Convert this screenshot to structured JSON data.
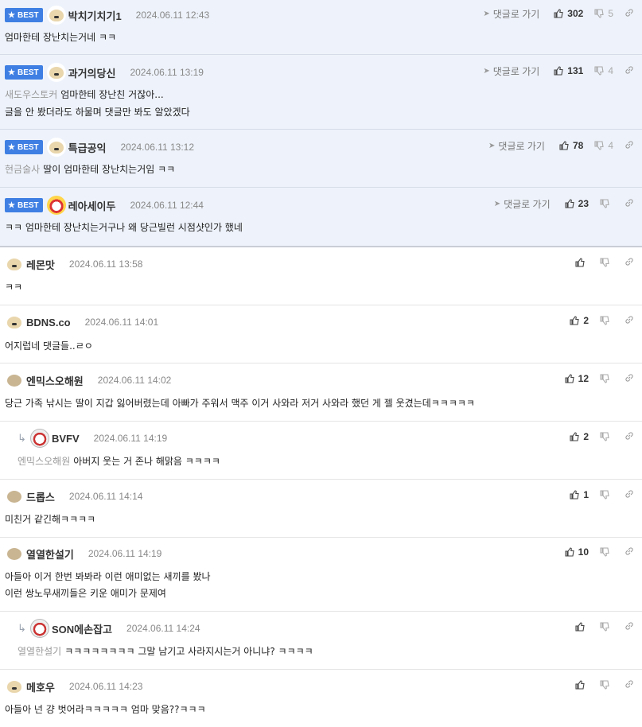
{
  "labels": {
    "best": "BEST",
    "reply_link": "댓글로 가기"
  },
  "comments": [
    {
      "nick": "박치기치기1",
      "date": "2024.06.11 12:43",
      "mention": "",
      "line1": "엄마한테 장난치는거네 ㅋㅋ",
      "line2": "",
      "up": "302",
      "down": "5"
    },
    {
      "nick": "과거의당신",
      "date": "2024.06.11 13:19",
      "mention": "새도우스토커",
      "line1": "엄마한테 장난친 거잖아...",
      "line2": "글을 안 봤더라도 하물며 댓글만 봐도 알았겠다",
      "up": "131",
      "down": "4"
    },
    {
      "nick": "특급공익",
      "date": "2024.06.11 13:12",
      "mention": "현금술사",
      "line1": "딸이 엄마한테 장난치는거임 ㅋㅋ",
      "line2": "",
      "up": "78",
      "down": "4"
    },
    {
      "nick": "레아세이두",
      "date": "2024.06.11 12:44",
      "mention": "",
      "line1": "ㅋㅋ 엄마한테 장난치는거구나 왜 당근빌런 시점샷인가 했네",
      "line2": "",
      "up": "23",
      "down": ""
    },
    {
      "nick": "레몬맛",
      "date": "2024.06.11 13:58",
      "mention": "",
      "line1": "ㅋㅋ",
      "line2": "",
      "up": "",
      "down": ""
    },
    {
      "nick": "BDNS.co",
      "date": "2024.06.11 14:01",
      "mention": "",
      "line1": "어지럽네 댓글들..ㄹㅇ",
      "line2": "",
      "up": "2",
      "down": ""
    },
    {
      "nick": "엔믹스오해원",
      "date": "2024.06.11 14:02",
      "mention": "",
      "line1": "당근 가족 낚시는 딸이 지갑 잃어버렸는데 아빠가 주워서 맥주 이거 사와라 저거 사와라 했던 게 젤 웃겼는데ㅋㅋㅋㅋㅋ",
      "line2": "",
      "up": "12",
      "down": ""
    },
    {
      "nick": "BVFV",
      "date": "2024.06.11 14:19",
      "mention": "엔믹스오해원",
      "line1": "아버지 웃는 거 존나 해맑음 ㅋㅋㅋㅋ",
      "line2": "",
      "up": "2",
      "down": ""
    },
    {
      "nick": "드롭스",
      "date": "2024.06.11 14:14",
      "mention": "",
      "line1": "미친거 같긴해ㅋㅋㅋㅋ",
      "line2": "",
      "up": "1",
      "down": ""
    },
    {
      "nick": "열열한설기",
      "date": "2024.06.11 14:19",
      "mention": "",
      "line1": "아들아 이거 한번 봐봐라 이런 애미없는 새끼를 봤나",
      "line2": "이런 쌍노무새끼들은 키운 애미가 문제여",
      "up": "10",
      "down": ""
    },
    {
      "nick": "SON에손잡고",
      "date": "2024.06.11 14:24",
      "mention": "열열한설기",
      "line1": "ㅋㅋㅋㅋㅋㅋㅋㅋ 그말 남기고 사라지시는거 아니냐? ㅋㅋㅋㅋ",
      "line2": "",
      "up": "",
      "down": ""
    },
    {
      "nick": "메호우",
      "date": "2024.06.11 14:23",
      "mention": "",
      "line1": "아들아 넌 걍 벗어라ㅋㅋㅋㅋㅋ 엄마 맞음??ㅋㅋㅋ",
      "line2": "",
      "up": "",
      "down": ""
    }
  ]
}
